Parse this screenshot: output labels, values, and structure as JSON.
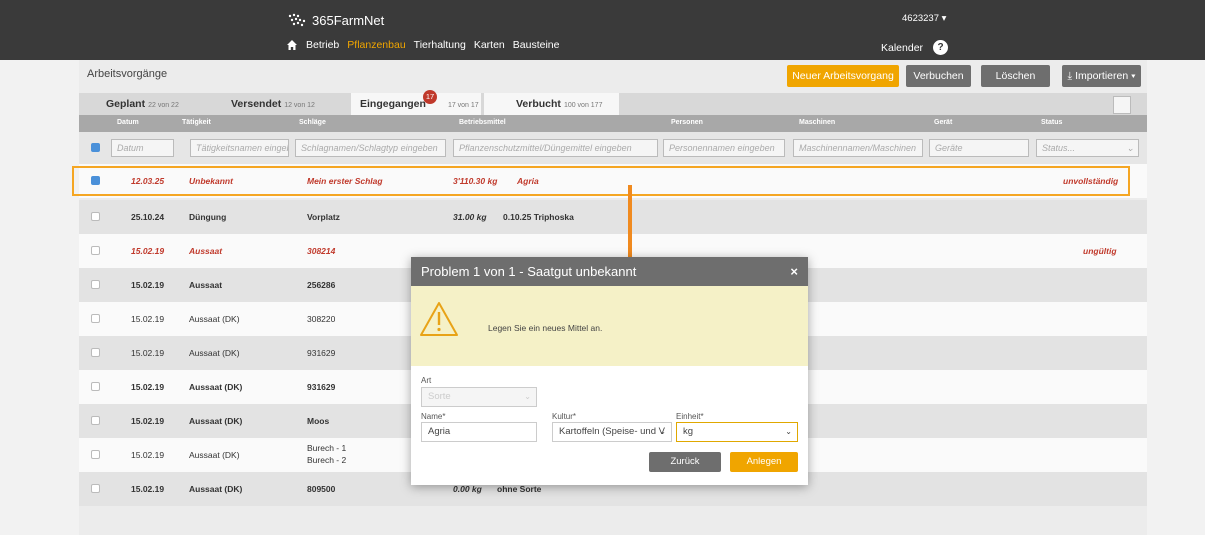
{
  "brand": {
    "name": "365FarmNet"
  },
  "nav": {
    "items": [
      "Betrieb",
      "Pflanzenbau",
      "Tierhaltung",
      "Karten",
      "Bausteine"
    ],
    "active": "Pflanzenbau"
  },
  "account": {
    "id": "4623237 ▾",
    "kalender": "Kalender",
    "help": "?"
  },
  "page": {
    "breadcrumb": "Arbeitsvorgänge"
  },
  "toolbar": {
    "neuer": "Neuer Arbeitsvorgang",
    "verbuchen": "Verbuchen",
    "loeschen": "Löschen",
    "importieren": "Importieren ▾"
  },
  "tabs": [
    {
      "label": "Geplant",
      "count": "22 von 22"
    },
    {
      "label": "Versendet",
      "count": "12 von 12"
    },
    {
      "label": "Eingegangen",
      "count": "17 von 17",
      "badge": "17"
    },
    {
      "label": "Verbucht",
      "count": "100 von 177"
    }
  ],
  "columns": [
    "Datum",
    "Tätigkeit",
    "Schläge",
    "Betriebsmittel",
    "Personen",
    "Maschinen",
    "Gerät",
    "Status"
  ],
  "filters": [
    "Datum",
    "Tätigkeitsnamen eingeb",
    "Schlagnamen/Schlagtyp eingeben",
    "Pflanzenschutzmittel/Düngemittel eingeben",
    "Personennamen eingeben",
    "Maschinennamen/Maschinen",
    "Geräte",
    "Status..."
  ],
  "rows": [
    {
      "date": "12.03.25",
      "activity": "Unbekannt",
      "field": "Mein erster Schlag",
      "qty": "3'110.30 kg",
      "mittel": "Agria",
      "status": "unvollständig"
    },
    {
      "date": "25.10.24",
      "activity": "Düngung",
      "field": "Vorplatz",
      "qty": "31.00 kg",
      "mittel": "0.10.25 Triphoska",
      "status": ""
    },
    {
      "date": "15.02.19",
      "activity": "Aussaat",
      "field": "308214",
      "qty": "",
      "mittel": "",
      "status": "ungültig"
    },
    {
      "date": "15.02.19",
      "activity": "Aussaat",
      "field": "256286",
      "qty": "",
      "mittel": "",
      "status": ""
    },
    {
      "date": "15.02.19",
      "activity": "Aussaat (DK)",
      "field": "308220",
      "qty": "",
      "mittel": "",
      "status": ""
    },
    {
      "date": "15.02.19",
      "activity": "Aussaat (DK)",
      "field": "931629",
      "qty": "",
      "mittel": "",
      "status": ""
    },
    {
      "date": "15.02.19",
      "activity": "Aussaat (DK)",
      "field": "931629",
      "qty": "",
      "mittel": "",
      "status": ""
    },
    {
      "date": "15.02.19",
      "activity": "Aussaat (DK)",
      "field": "Moos",
      "qty": "",
      "mittel": "",
      "status": ""
    },
    {
      "date": "15.02.19",
      "activity": "Aussaat (DK)",
      "field": "Burech - 1",
      "field2": "Burech - 2",
      "qty": "",
      "mittel": "",
      "status": ""
    },
    {
      "date": "15.02.19",
      "activity": "Aussaat (DK)",
      "field": "809500",
      "qty": "0.00 kg",
      "mittel": "ohne Sorte",
      "status": ""
    }
  ],
  "dialog": {
    "title": "Problem 1 von 1 - Saatgut unbekannt",
    "close": "×",
    "message": "Legen Sie ein neues Mittel an.",
    "art_label": "Art",
    "art_value": "Sorte",
    "name_label": "Name*",
    "name_value": "Agria",
    "kultur_label": "Kultur*",
    "kultur_value": "Kartoffeln (Speise- und V",
    "einheit_label": "Einheit*",
    "einheit_value": "kg",
    "back": "Zurück",
    "create": "Anlegen"
  },
  "colors": {
    "accent": "#f0a500",
    "red": "#c0392b",
    "highlight": "#f5a623"
  }
}
